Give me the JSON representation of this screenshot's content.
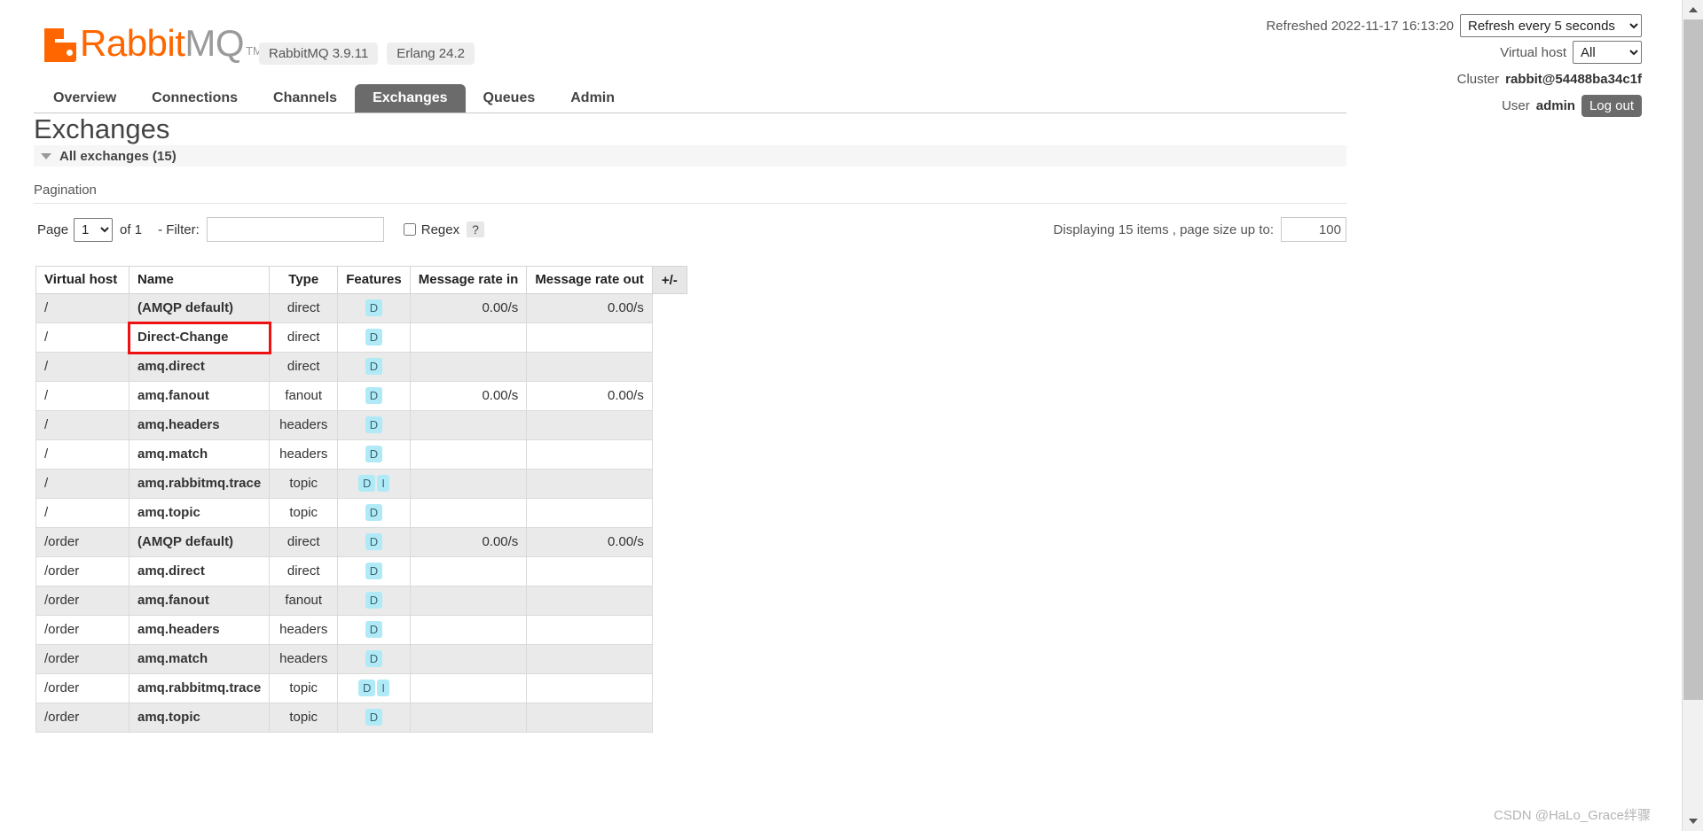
{
  "header": {
    "logo_rabbit": "Rabbit",
    "logo_mq": "MQ",
    "logo_tm": "TM",
    "versions": [
      "RabbitMQ 3.9.11",
      "Erlang 24.2"
    ],
    "refreshed_text": "Refreshed 2022-11-17 16:13:20",
    "refresh_select_value": "Refresh every 5 seconds",
    "refresh_options": [
      "Refresh every 5 seconds"
    ],
    "vhost_label": "Virtual host",
    "vhost_select_value": "All",
    "vhost_options": [
      "All"
    ],
    "cluster_label": "Cluster",
    "cluster_name": "rabbit@54488ba34c1f",
    "user_label": "User",
    "user_name": "admin",
    "logout_label": "Log out"
  },
  "nav": {
    "tabs": [
      {
        "label": "Overview",
        "active": false
      },
      {
        "label": "Connections",
        "active": false
      },
      {
        "label": "Channels",
        "active": false
      },
      {
        "label": "Exchanges",
        "active": true
      },
      {
        "label": "Queues",
        "active": false
      },
      {
        "label": "Admin",
        "active": false
      }
    ]
  },
  "main": {
    "page_title": "Exchanges",
    "section_label": "All exchanges (15)",
    "pagination_label": "Pagination",
    "page_text": "Page",
    "page_value": "1",
    "page_options": [
      "1"
    ],
    "of_text": "of 1",
    "filter_label": "- Filter:",
    "filter_value": "",
    "filter_placeholder": "",
    "regex_label": "Regex",
    "regex_help": "?",
    "regex_checked": false,
    "displaying_text": "Displaying 15 items , page size up to:",
    "page_size_value": "100"
  },
  "table": {
    "columns": [
      "Virtual host",
      "Name",
      "Type",
      "Features",
      "Message rate in",
      "Message rate out"
    ],
    "plusminus_label": "+/-",
    "rows": [
      {
        "vhost": "/",
        "name": "(AMQP default)",
        "type": "direct",
        "features": [
          "D"
        ],
        "rate_in": "0.00/s",
        "rate_out": "0.00/s"
      },
      {
        "vhost": "/",
        "name": "Direct-Change",
        "type": "direct",
        "features": [
          "D"
        ],
        "rate_in": "",
        "rate_out": "",
        "highlighted": true
      },
      {
        "vhost": "/",
        "name": "amq.direct",
        "type": "direct",
        "features": [
          "D"
        ],
        "rate_in": "",
        "rate_out": ""
      },
      {
        "vhost": "/",
        "name": "amq.fanout",
        "type": "fanout",
        "features": [
          "D"
        ],
        "rate_in": "0.00/s",
        "rate_out": "0.00/s"
      },
      {
        "vhost": "/",
        "name": "amq.headers",
        "type": "headers",
        "features": [
          "D"
        ],
        "rate_in": "",
        "rate_out": ""
      },
      {
        "vhost": "/",
        "name": "amq.match",
        "type": "headers",
        "features": [
          "D"
        ],
        "rate_in": "",
        "rate_out": ""
      },
      {
        "vhost": "/",
        "name": "amq.rabbitmq.trace",
        "type": "topic",
        "features": [
          "D",
          "I"
        ],
        "rate_in": "",
        "rate_out": ""
      },
      {
        "vhost": "/",
        "name": "amq.topic",
        "type": "topic",
        "features": [
          "D"
        ],
        "rate_in": "",
        "rate_out": ""
      },
      {
        "vhost": "/order",
        "name": "(AMQP default)",
        "type": "direct",
        "features": [
          "D"
        ],
        "rate_in": "0.00/s",
        "rate_out": "0.00/s"
      },
      {
        "vhost": "/order",
        "name": "amq.direct",
        "type": "direct",
        "features": [
          "D"
        ],
        "rate_in": "",
        "rate_out": ""
      },
      {
        "vhost": "/order",
        "name": "amq.fanout",
        "type": "fanout",
        "features": [
          "D"
        ],
        "rate_in": "",
        "rate_out": ""
      },
      {
        "vhost": "/order",
        "name": "amq.headers",
        "type": "headers",
        "features": [
          "D"
        ],
        "rate_in": "",
        "rate_out": ""
      },
      {
        "vhost": "/order",
        "name": "amq.match",
        "type": "headers",
        "features": [
          "D"
        ],
        "rate_in": "",
        "rate_out": ""
      },
      {
        "vhost": "/order",
        "name": "amq.rabbitmq.trace",
        "type": "topic",
        "features": [
          "D",
          "I"
        ],
        "rate_in": "",
        "rate_out": ""
      },
      {
        "vhost": "/order",
        "name": "amq.topic",
        "type": "topic",
        "features": [
          "D"
        ],
        "rate_in": "",
        "rate_out": ""
      }
    ]
  },
  "watermark": "CSDN @HaLo_Grace绊骤",
  "colors": {
    "brand_orange": "#ff6600",
    "tab_active_bg": "#6b6b6b",
    "feature_badge_bg": "#b0eaf7",
    "highlight_border": "#ee1111",
    "row_even_bg": "#eaeaea"
  }
}
